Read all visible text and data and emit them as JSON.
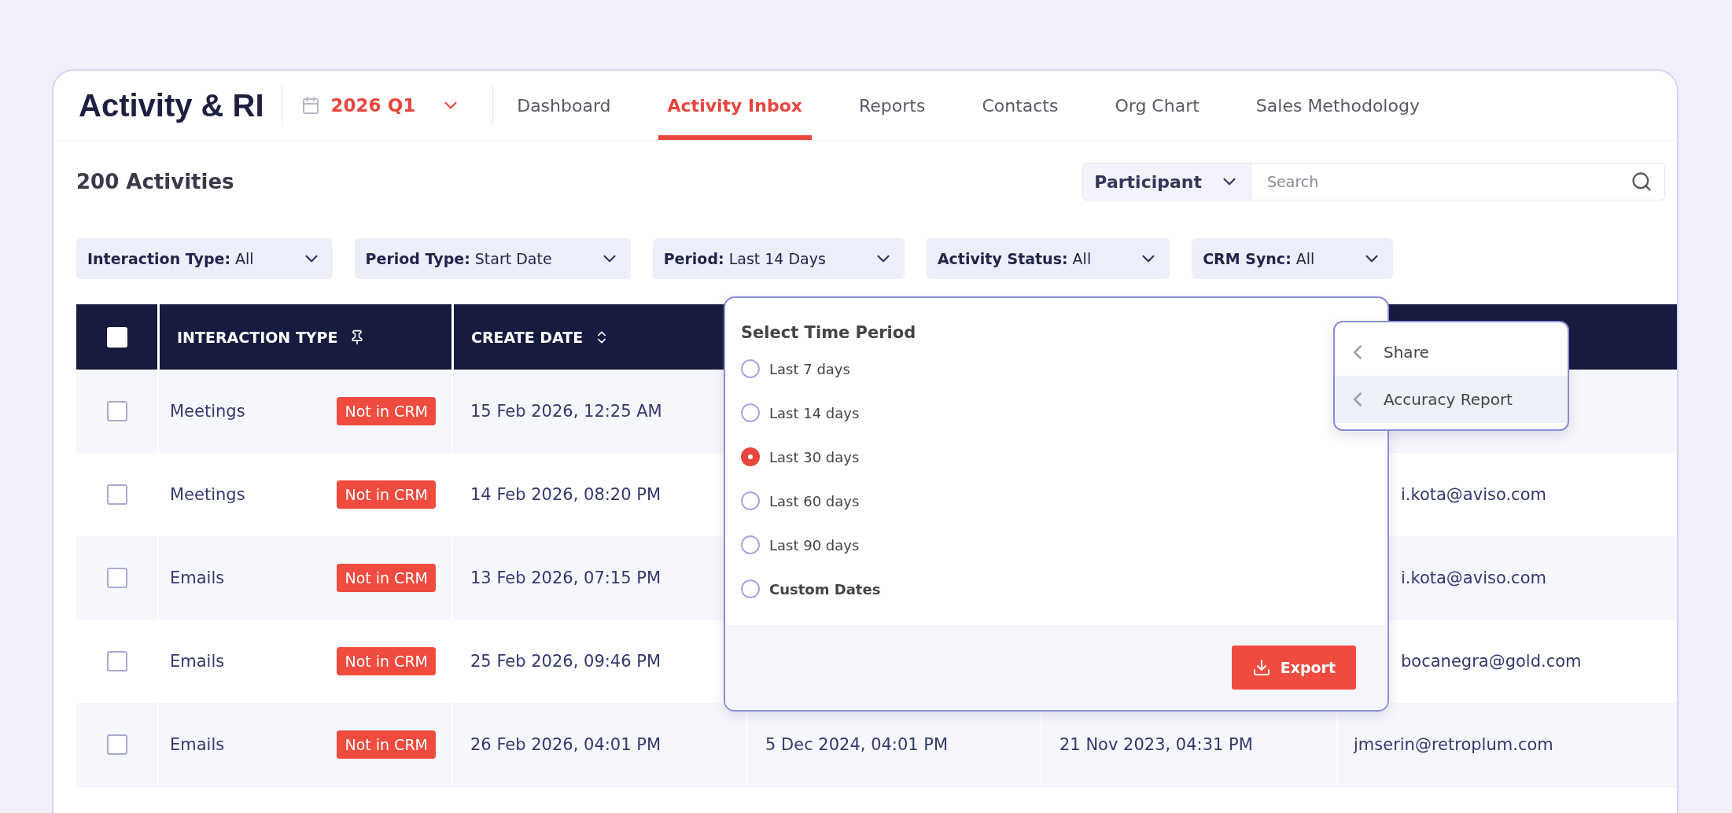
{
  "app": {
    "title": "Activity & RI"
  },
  "period_picker": {
    "value": "2026 Q1"
  },
  "nav_tabs": [
    {
      "label": "Dashboard",
      "selected": false
    },
    {
      "label": "Activity Inbox",
      "selected": true
    },
    {
      "label": "Reports",
      "selected": false
    },
    {
      "label": "Contacts",
      "selected": false
    },
    {
      "label": "Org Chart",
      "selected": false
    },
    {
      "label": "Sales Methodology",
      "selected": false
    }
  ],
  "activity_count": "200 Activities",
  "search": {
    "scope": "Participant",
    "placeholder": "Search"
  },
  "filters": [
    {
      "label": "Interaction Type:",
      "value": "All"
    },
    {
      "label": "Period Type:",
      "value": "Start Date"
    },
    {
      "label": "Period:",
      "value": "Last 14 Days"
    },
    {
      "label": "Activity Status:",
      "value": "All"
    },
    {
      "label": "CRM Sync:",
      "value": "All"
    }
  ],
  "table": {
    "select_all_checked": false,
    "columns": [
      {
        "label": "INTERACTION TYPE",
        "kind": "pinned"
      },
      {
        "label": "CREATE DATE",
        "kind": "sortable"
      }
    ],
    "rows": [
      {
        "checked": false,
        "interaction_type": "Meetings",
        "crm_status": "Not in CRM",
        "create_date": "15 Feb 2026, 12:25 AM"
      },
      {
        "checked": false,
        "interaction_type": "Meetings",
        "crm_status": "Not in CRM",
        "create_date": "14 Feb 2026, 08:20 PM",
        "column_6": "i.kota@aviso.com"
      },
      {
        "checked": false,
        "interaction_type": "Emails",
        "crm_status": "Not in CRM",
        "create_date": "13 Feb 2026, 07:15 PM",
        "column_6": "i.kota@aviso.com"
      },
      {
        "checked": false,
        "interaction_type": "Emails",
        "crm_status": "Not in CRM",
        "create_date": "25 Feb 2026, 09:46 PM",
        "column_6": "bocanegra@gold.com"
      },
      {
        "checked": false,
        "interaction_type": "Emails",
        "crm_status": "Not in CRM",
        "create_date": "26 Feb 2026, 04:01 PM",
        "column_4": "5 Dec 2024, 04:01 PM",
        "column_5": "21 Nov 2023, 04:31 PM",
        "column_6": "jmserin@retroplum.com"
      }
    ]
  },
  "time_period": {
    "title": "Select Time Period",
    "options": [
      {
        "label": "Last 7 days",
        "kind": "preset",
        "selected": false
      },
      {
        "label": "Last 14 days",
        "kind": "preset",
        "selected": false
      },
      {
        "label": "Last 30 days",
        "kind": "preset",
        "selected": true
      },
      {
        "label": "Last 60 days",
        "kind": "preset",
        "selected": false
      },
      {
        "label": "Last 90 days",
        "kind": "preset",
        "selected": false
      },
      {
        "label": "Custom Dates",
        "kind": "custom",
        "selected": false
      }
    ],
    "button": "Export"
  },
  "context_menu": [
    {
      "label": "Share",
      "highlighted": false
    },
    {
      "label": "Accuracy Report",
      "highlighted": true
    }
  ]
}
